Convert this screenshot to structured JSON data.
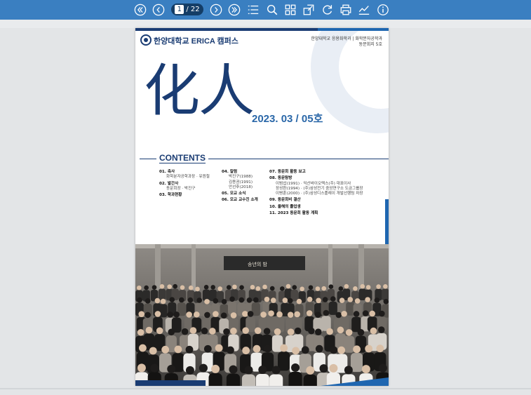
{
  "toolbar": {
    "page_current": "1",
    "page_total": "/ 22",
    "icons": [
      "first-page-icon",
      "prev-page-icon",
      "next-page-icon",
      "last-page-icon",
      "toc-list-icon",
      "search-icon",
      "thumbnails-icon",
      "expand-icon",
      "rotate-icon",
      "print-icon",
      "statistics-icon",
      "info-icon"
    ]
  },
  "document": {
    "university": "한양대학교 ERICA 캠퍼스",
    "dept_line1": "한양대학교 응용화학과 | 화학분자공학과",
    "dept_line2": "동문회지 5호",
    "title": "化人",
    "issue": "2023. 03 / 05호",
    "contents_heading": "CONTENTS",
    "toc": {
      "col1": [
        {
          "type": "h",
          "text": "01. 축사"
        },
        {
          "type": "s",
          "text": "화학분자공학과장 · 유원철"
        },
        {
          "type": "h",
          "text": "02. 발간사"
        },
        {
          "type": "s",
          "text": "동문회장 · 박진구"
        },
        {
          "type": "h",
          "text": "03. 학과현황"
        }
      ],
      "col2": [
        {
          "type": "h",
          "text": "04. 칼럼"
        },
        {
          "type": "s",
          "text": "박진구(1988)"
        },
        {
          "type": "s",
          "text": "김용권(1991)"
        },
        {
          "type": "s",
          "text": "안선후(2018)"
        },
        {
          "type": "h",
          "text": "05. 모교 소식"
        },
        {
          "type": "h",
          "text": "06. 모교 교수진 소개"
        }
      ],
      "col3": [
        {
          "type": "h",
          "text": "07. 동문회 활동 보고"
        },
        {
          "type": "h",
          "text": "08. 동문탐방"
        },
        {
          "type": "s2",
          "text": "이범섭(1991) · 익산바이오텍스(주) 대표이사"
        },
        {
          "type": "s2",
          "text": "장성환(1994) · (주)삼성전기 중앙연구소 도금그룹장"
        },
        {
          "type": "s2",
          "text": "이병훈(2000) · (주)삼성디스플레이 개발선행팀 차장"
        },
        {
          "type": "h",
          "text": "09. 동문회비 결산"
        },
        {
          "type": "h",
          "text": "10. 올해의 졸업생"
        },
        {
          "type": "h",
          "text": "11. 2023 동문회 활동 계획"
        }
      ]
    },
    "photo_banner": "송년의 밤"
  }
}
